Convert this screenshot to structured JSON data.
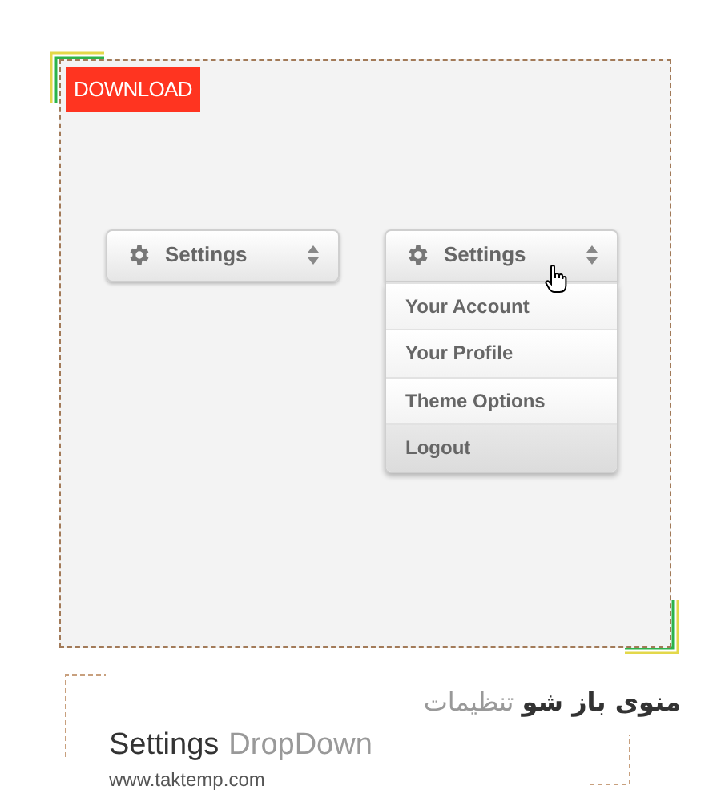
{
  "badge": {
    "label": "DOWNLOAD"
  },
  "dropdowns": [
    {
      "label": "Settings",
      "expanded": false
    },
    {
      "label": "Settings",
      "expanded": true,
      "items": [
        {
          "label": "Your Account",
          "selected": false
        },
        {
          "label": "Your Profile",
          "selected": false
        },
        {
          "label": "Theme Options",
          "selected": false
        },
        {
          "label": "Logout",
          "selected": true
        }
      ]
    }
  ],
  "caption": {
    "subtitle_parts": [
      {
        "text": "منوی باز شو",
        "color": "#333333"
      },
      {
        "text": "تنظیمات",
        "color": "#999999"
      }
    ],
    "title_parts": [
      {
        "text": "Settings",
        "color": "#333333"
      },
      {
        "text": "DropDown",
        "color": "#999999"
      }
    ],
    "url": "www.taktemp.com"
  }
}
